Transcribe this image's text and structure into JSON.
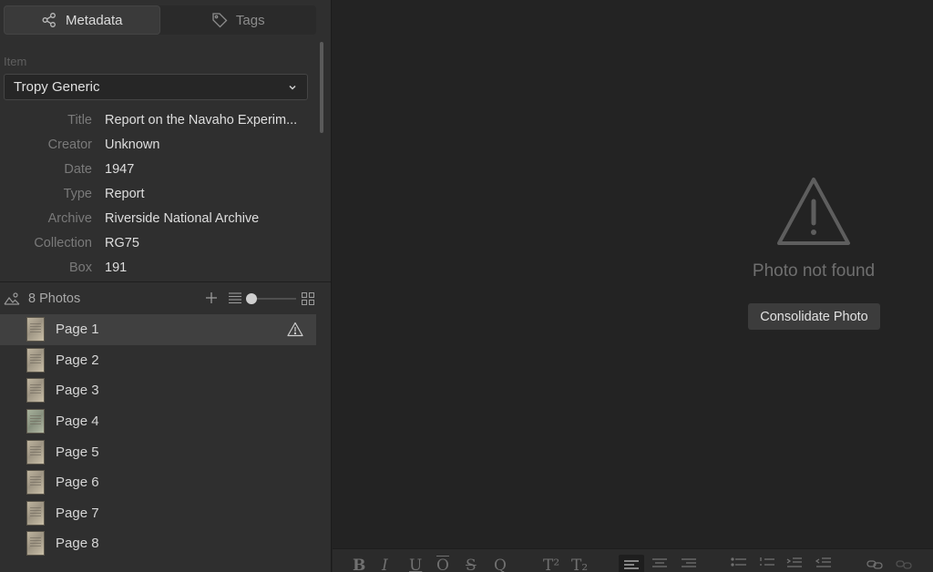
{
  "tabs": [
    {
      "label": "Metadata",
      "icon": "share-nodes-icon",
      "active": true
    },
    {
      "label": "Tags",
      "icon": "tag-icon",
      "active": false
    }
  ],
  "item": {
    "section_label": "Item",
    "template": "Tropy Generic",
    "fields": [
      {
        "label": "Title",
        "value": "Report on the Navaho Experim..."
      },
      {
        "label": "Creator",
        "value": "Unknown"
      },
      {
        "label": "Date",
        "value": "1947"
      },
      {
        "label": "Type",
        "value": "Report"
      },
      {
        "label": "Archive",
        "value": "Riverside National Archive"
      },
      {
        "label": "Collection",
        "value": "RG75"
      },
      {
        "label": "Box",
        "value": "191"
      }
    ]
  },
  "photos": {
    "count_label": "8 Photos",
    "zoom_level": 0,
    "items": [
      {
        "label": "Page 1",
        "selected": true,
        "missing": true
      },
      {
        "label": "Page 2"
      },
      {
        "label": "Page 3"
      },
      {
        "label": "Page 4"
      },
      {
        "label": "Page 5"
      },
      {
        "label": "Page 6"
      },
      {
        "label": "Page 7"
      },
      {
        "label": "Page 8"
      }
    ]
  },
  "viewer": {
    "message": "Photo not found",
    "action_label": "Consolidate Photo"
  },
  "toolbar": {
    "bold": "B",
    "italic": "I",
    "underline": "U",
    "overline": "O",
    "strikethrough": "S",
    "quote": "Q",
    "superscript": "T²",
    "subscript": "T₂"
  },
  "colors": {
    "panel_bg": "#2f2f2f",
    "viewer_bg": "#232323",
    "selected_row": "#404040",
    "text": "#d8d8d8",
    "muted": "#7a7a7a"
  }
}
